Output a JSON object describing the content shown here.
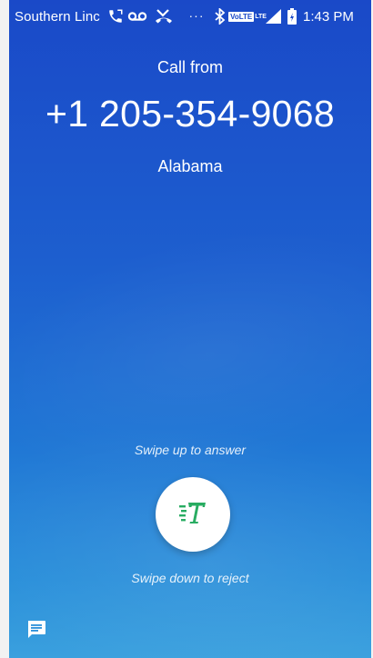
{
  "status_bar": {
    "carrier": "Southern Linc",
    "more": "···",
    "volte": "VoLTE",
    "lte": "LTE",
    "time": "1:43 PM"
  },
  "call": {
    "label": "Call from",
    "number": "+1 205-354-9068",
    "location": "Alabama"
  },
  "swipe": {
    "answer_hint": "Swipe up to answer",
    "reject_hint": "Swipe down to reject"
  },
  "icons": {
    "status": [
      "call-icon",
      "voicemail-icon",
      "missed-call-icon",
      "more-icon",
      "bluetooth-icon",
      "volte-icon",
      "signal-icon",
      "battery-icon"
    ],
    "answer": "rtt-icon",
    "message": "message-icon"
  },
  "colors": {
    "background_top": "#1a49c8",
    "background_bottom": "#3aa0de",
    "answer_icon": "#1ea85a",
    "text": "#ffffff"
  }
}
